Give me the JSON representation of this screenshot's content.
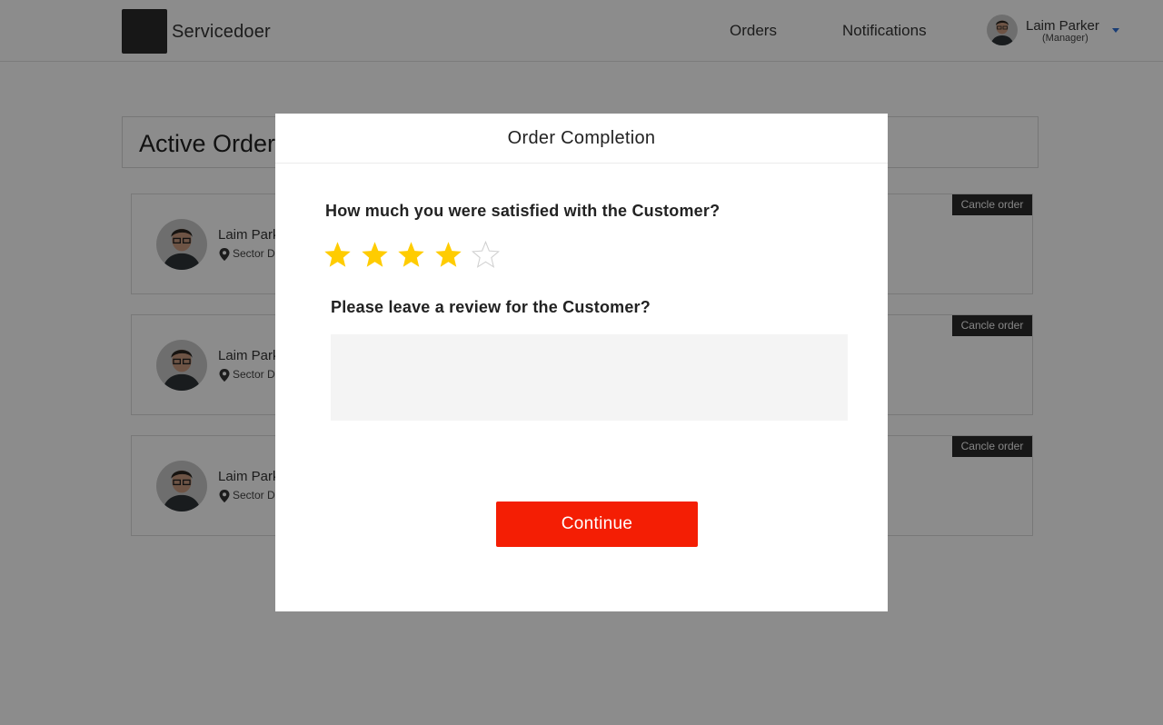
{
  "header": {
    "brand": "Servicedoer",
    "nav": {
      "orders": "Orders",
      "notifications": "Notifications"
    },
    "user": {
      "name": "Laim Parker",
      "role": "(Manager)"
    }
  },
  "page": {
    "title": "Active Orders"
  },
  "orders": [
    {
      "customer": "Laim Parker",
      "location": "Sector D",
      "cancel_label": "Cancle order"
    },
    {
      "customer": "Laim Parker",
      "location": "Sector D",
      "cancel_label": "Cancle order"
    },
    {
      "customer": "Laim Parker",
      "location": "Sector D",
      "cancel_label": "Cancle order"
    }
  ],
  "modal": {
    "title": "Order Completion",
    "rating_question": "How much you were satisfied with the Customer?",
    "rating": {
      "value": 4,
      "max": 5
    },
    "review_question": "Please leave a review for the Customer?",
    "review_value": "",
    "continue_label": "Continue"
  },
  "colors": {
    "accent": "#f41e04",
    "star_filled": "#ffcc00",
    "overlay": "rgba(0,0,0,0.45)"
  }
}
